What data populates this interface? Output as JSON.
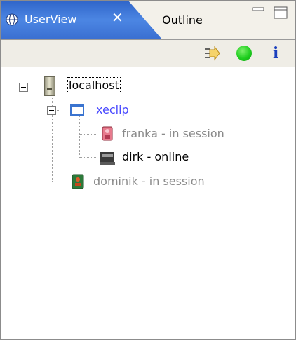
{
  "tabs": [
    {
      "label": "UserView",
      "active": true
    },
    {
      "label": "Outline",
      "active": false
    }
  ],
  "colors": {
    "active_tab": "#3a6fd1",
    "online_status": "#1fce1f",
    "group_label": "#4a4aff",
    "inactive_label": "#8a8a8a",
    "info_icon": "#1a3fbd"
  },
  "icons": {
    "view": "globe-icon",
    "close": "close-icon",
    "minimize": "minimize-icon",
    "maximize": "maximize-icon",
    "toolbar_forward": "forward-icon",
    "toolbar_status": "status-online-icon",
    "toolbar_info": "info-icon"
  },
  "tree": {
    "root": {
      "label": "localhost"
    },
    "group": {
      "label": "xeclip"
    },
    "users": [
      {
        "label": "franka - in session"
      },
      {
        "label": "dirk - online"
      },
      {
        "label": "dominik - in session"
      }
    ]
  }
}
